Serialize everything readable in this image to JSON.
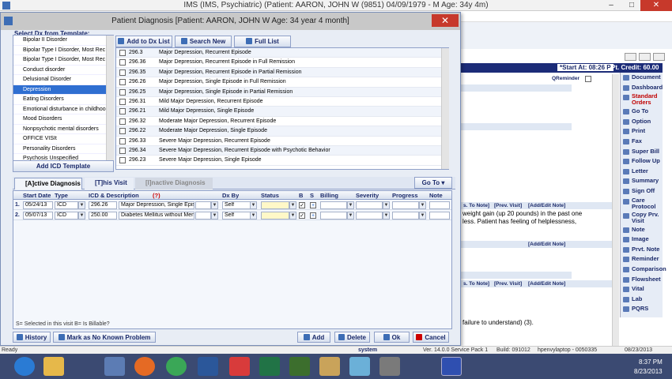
{
  "app": {
    "window_title": "IMS (IMS, Psychiatric)    (Patient: AARON, JOHN W (9851) 04/09/1979 - M Age: 34y 4m)",
    "start_at": "*Start At: 08:26 P",
    "pt_credit": "Pt. Credit: 60.00",
    "qreminder": "QReminder",
    "right_sidebar": [
      "Document",
      "Dashboard",
      "Standard Orders",
      "Go To",
      "Option",
      "Print",
      "Fax",
      "Super Bill",
      "Follow Up",
      "Letter",
      "Summary",
      "Sign Off",
      "Care Protocol",
      "Copy Prv. Visit",
      "Note",
      "Image",
      "Prvt. Note",
      "Reminder",
      "Comparison",
      "Flowsheet",
      "Vital",
      "Lab",
      "PQRS"
    ],
    "bg_links_1": [
      "s. To Note]",
      "[Prev. Visit]",
      "[Add/Edit Note]"
    ],
    "bg_text_1": "weight gain (up 20 pounds)  in the past one",
    "bg_text_2": "less. Patient has feeling of helplessness,",
    "bg_link_2": "[Add/Edit Note]",
    "bg_links_3": [
      "s. To Note]",
      "[Prev. Visit]",
      "[Add/Edit Note]"
    ],
    "bg_text_3": "failure to understand) (3).",
    "status_left": "Ready",
    "status_items": [
      "system",
      "Ver. 14.0.0 Service Pack 1",
      "Build: 091012",
      "hpenvylaptop - 0050335",
      "08/23/2013"
    ],
    "clock_time": "8:37 PM",
    "clock_date": "8/23/2013"
  },
  "dialog": {
    "title": "Patient Diagnosis  [Patient: AARON, JOHN W  Age: 34 year 4 month]",
    "template_label": "Select Dx from Template:",
    "templates": [
      "Bipolar II Disorder",
      "Bipolar Type I Disorder, Most Rec",
      "Bipolar Type I Disorder, Most Rec",
      "Conduct disorder",
      "Delusional Disorder",
      "Depression",
      "Eating Disorders",
      "Emotional disturbance in childhoo",
      "Mood Disorders",
      "Nonpsychotic mental disorders",
      "OFFICE VISIt",
      "Personality Disorders",
      "Psychosis Unspecified"
    ],
    "selected_template": "Depression",
    "add_icd_template": "Add ICD Template",
    "add_to_dx_list": "Add to Dx List",
    "search_new": "Search New",
    "full_list": "Full List",
    "dx_codes": [
      {
        "code": "296.3",
        "desc": "Major Depression, Recurrent Episode"
      },
      {
        "code": "296.36",
        "desc": "Major Depression, Recurrent Episode in Full Remission"
      },
      {
        "code": "296.35",
        "desc": "Major Depression, Recurrent Episode in Partial Remission"
      },
      {
        "code": "296.26",
        "desc": "Major Depression, Single Episode in Full Remission"
      },
      {
        "code": "296.25",
        "desc": "Major Depression, Single Episode in Partial Remission"
      },
      {
        "code": "296.31",
        "desc": "Mild Major Depression, Recurrent Episode"
      },
      {
        "code": "296.21",
        "desc": "Mild Major Depression, Single Episode"
      },
      {
        "code": "296.32",
        "desc": "Moderate Major Depression, Recurrent Episode"
      },
      {
        "code": "296.22",
        "desc": "Moderate Major Depression, Single Episode"
      },
      {
        "code": "296.33",
        "desc": "Severe Major Depression, Recurrent Episode"
      },
      {
        "code": "296.34",
        "desc": "Severe Major Depression, Recurrent Episode with Psychotic Behavior"
      },
      {
        "code": "296.23",
        "desc": "Severe Major Depression, Single Episode"
      }
    ],
    "tabs": [
      "[A]ctive Diagnosis",
      "[T]his Visit",
      "[I]nactive Diagnosis"
    ],
    "goto": "Go To",
    "columns": [
      "Start Date",
      "Type",
      "ICD & Description",
      "(?)",
      "Dx By",
      "Status",
      "B",
      "S",
      "Billing",
      "Severity",
      "Progress",
      "Note"
    ],
    "rows": [
      {
        "num": "1.",
        "date": "05/24/13",
        "type": "ICD",
        "code": "296.26",
        "desc": "Major Depression, Single Episo",
        "dxby": "Self"
      },
      {
        "num": "2.",
        "date": "05/07/13",
        "type": "ICD",
        "code": "250.00",
        "desc": "Diabetes Mellitus without Mentio",
        "dxby": "Self"
      }
    ],
    "footnote": "S= Selected in this visit   B= Is Billable?",
    "buttons": {
      "history": "History",
      "no_known": "Mark as No Known Problem",
      "add": "Add",
      "delete": "Delete",
      "ok": "Ok",
      "cancel": "Cancel"
    }
  }
}
